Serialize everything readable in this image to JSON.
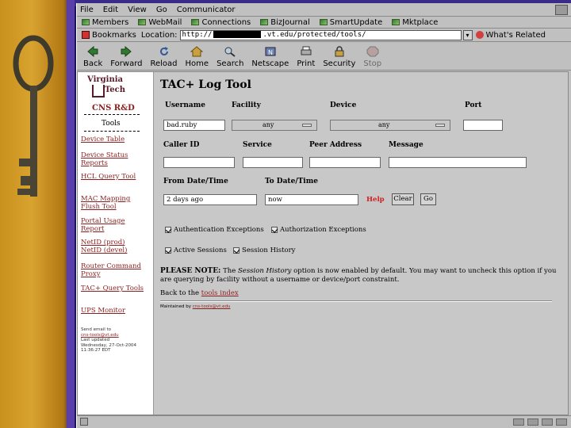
{
  "menubar": {
    "items": [
      "File",
      "Edit",
      "View",
      "Go",
      "Communicator"
    ]
  },
  "personal_toolbar": {
    "items": [
      "Members",
      "WebMail",
      "Connections",
      "BizJournal",
      "SmartUpdate",
      "Mktplace"
    ]
  },
  "location_bar": {
    "bookmarks": "Bookmarks",
    "location_label": "Location:",
    "url_prefix": "http://",
    "url_suffix": ".vt.edu/protected/tools/",
    "related": "What's Related"
  },
  "nav_toolbar": {
    "buttons": [
      "Back",
      "Forward",
      "Reload",
      "Home",
      "Search",
      "Netscape",
      "Print",
      "Security",
      "Stop"
    ]
  },
  "sidebar": {
    "logo_line1": "Virginia",
    "logo_line2": "Tech",
    "group": "CNS R&D",
    "tools_heading": "Tools",
    "links": [
      "Device Table",
      "Device Status Reports",
      "HCL Query Tool",
      "MAC Mapping Flush Tool",
      "Portal Usage Report",
      "NetID (prod) NetID (devel)",
      "Router Command Proxy",
      "TAC+ Query Tools",
      "UPS Monitor"
    ],
    "footer_lines": [
      "Send email to",
      "cns-tools@vt.edu",
      "Last updated",
      "Wednesday, 27-Oct-2004",
      "11:36:27 EDT"
    ]
  },
  "main": {
    "title": "TAC+ Log Tool",
    "labels": {
      "username": "Username",
      "facility": "Facility",
      "device": "Device",
      "port": "Port",
      "caller_id": "Caller ID",
      "service": "Service",
      "peer_address": "Peer Address",
      "message": "Message",
      "from": "From Date/Time",
      "to": "To Date/Time"
    },
    "values": {
      "username": "bad.ruby",
      "facility": "any",
      "device": "any",
      "port": "",
      "caller_id": "",
      "service": "",
      "peer_address": "",
      "message": "",
      "from": "2 days ago",
      "to": "now"
    },
    "buttons": {
      "help": "Help",
      "clear": "Clear",
      "go": "Go"
    },
    "checkboxes": [
      "Authentication Exceptions",
      "Authorization Exceptions",
      "Active Sessions",
      "Session History"
    ],
    "note": {
      "prefix": "PLEASE NOTE:",
      "text_a": " The ",
      "em": "Session History",
      "text_b": " option is now enabled by default. You may want to uncheck this option if you are querying by facility without a username or device/port constraint."
    },
    "back_prefix": "Back to the ",
    "back_link": "tools index",
    "maintainer_prefix": "Maintained by ",
    "maintainer_link": "cns-tools@vt.edu"
  },
  "colors": {
    "accent": "#8a1f1f",
    "help": "#d02020",
    "slide_bg": "#2b1d6e"
  }
}
